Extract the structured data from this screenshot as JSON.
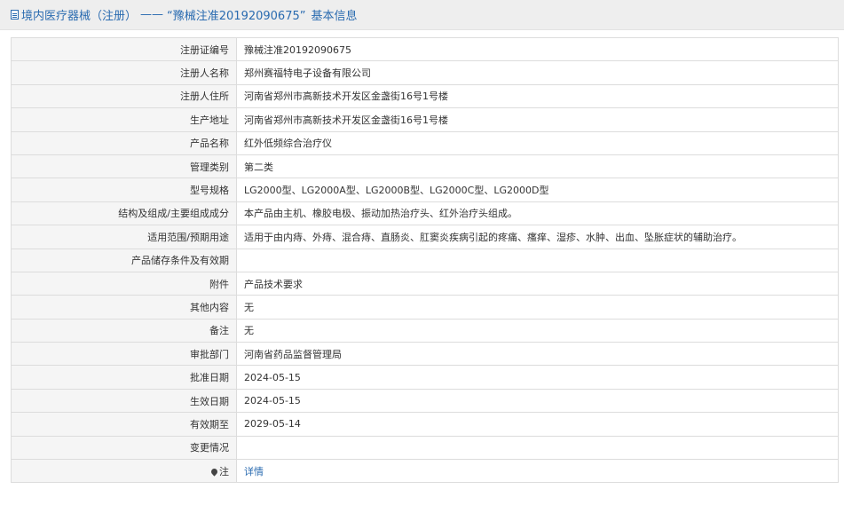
{
  "header": {
    "category": "境内医疗器械（注册）",
    "separator": "——",
    "reg_title": "“豫械注准20192090675”",
    "suffix": "基本信息"
  },
  "rows": [
    {
      "label": "注册证编号",
      "value": "豫械注准20192090675"
    },
    {
      "label": "注册人名称",
      "value": "郑州赛福特电子设备有限公司"
    },
    {
      "label": "注册人住所",
      "value": "河南省郑州市高新技术开发区金盏街16号1号楼"
    },
    {
      "label": "生产地址",
      "value": "河南省郑州市高新技术开发区金盏街16号1号楼"
    },
    {
      "label": "产品名称",
      "value": "红外低频综合治疗仪"
    },
    {
      "label": "管理类别",
      "value": "第二类"
    },
    {
      "label": "型号规格",
      "value": "LG2000型、LG2000A型、LG2000B型、LG2000C型、LG2000D型"
    },
    {
      "label": "结构及组成/主要组成成分",
      "value": "本产品由主机、橡胶电极、振动加热治疗头、红外治疗头组成。"
    },
    {
      "label": "适用范围/预期用途",
      "value": "适用于由内痔、外痔、混合痔、直肠炎、肛窦炎疾病引起的疼痛、瘙痒、湿疹、水肿、出血、坠胀症状的辅助治疗。"
    },
    {
      "label": "产品储存条件及有效期",
      "value": ""
    },
    {
      "label": "附件",
      "value": "产品技术要求"
    },
    {
      "label": "其他内容",
      "value": "无"
    },
    {
      "label": "备注",
      "value": "无"
    },
    {
      "label": "审批部门",
      "value": "河南省药品监督管理局"
    },
    {
      "label": "批准日期",
      "value": "2024-05-15"
    },
    {
      "label": "生效日期",
      "value": "2024-05-15"
    },
    {
      "label": "有效期至",
      "value": "2029-05-14"
    },
    {
      "label": "变更情况",
      "value": ""
    }
  ],
  "note_row": {
    "label": "注",
    "link_text": "详情",
    "icon": "pin-icon"
  },
  "colors": {
    "accent": "#2a6bb0",
    "label_bg": "#f5f5f5",
    "header_bg": "#eeeeee",
    "border": "#dcdcdc"
  }
}
